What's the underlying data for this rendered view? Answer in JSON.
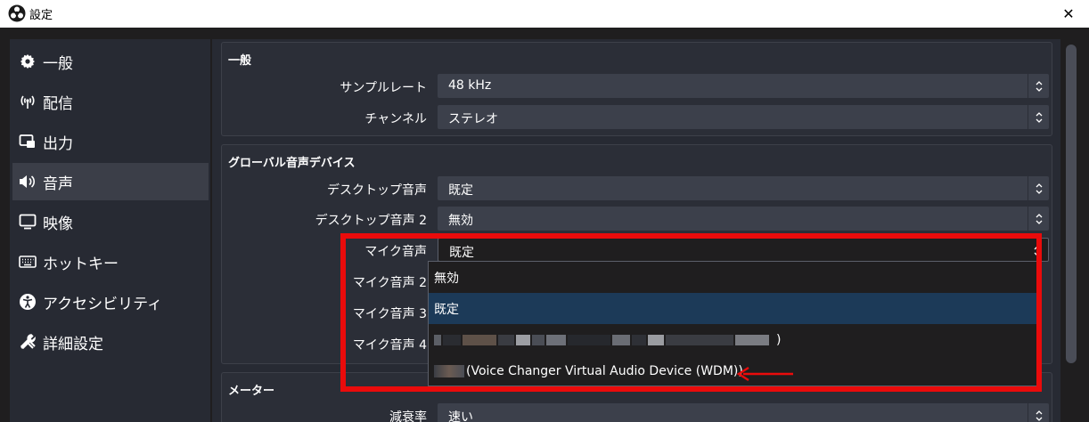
{
  "window": {
    "title": "設定",
    "close_glyph": "✕"
  },
  "sidebar": {
    "items": [
      {
        "label": "一般",
        "icon": "gear-icon"
      },
      {
        "label": "配信",
        "icon": "broadcast-icon"
      },
      {
        "label": "出力",
        "icon": "output-icon"
      },
      {
        "label": "音声",
        "icon": "speaker-icon",
        "active": true
      },
      {
        "label": "映像",
        "icon": "monitor-icon"
      },
      {
        "label": "ホットキー",
        "icon": "keyboard-icon"
      },
      {
        "label": "アクセシビリティ",
        "icon": "accessibility-icon"
      },
      {
        "label": "詳細設定",
        "icon": "tools-icon"
      }
    ]
  },
  "general_group": {
    "title": "一般",
    "sample_rate_label": "サンプルレート",
    "sample_rate_value": "48 kHz",
    "channels_label": "チャンネル",
    "channels_value": "ステレオ"
  },
  "devices_group": {
    "title": "グローバル音声デバイス",
    "desktop_label": "デスクトップ音声",
    "desktop_value": "既定",
    "desktop2_label": "デスクトップ音声 2",
    "desktop2_value": "無効",
    "mic_label": "マイク音声",
    "mic_value": "既定",
    "mic2_label": "マイク音声 2",
    "mic3_label": "マイク音声 3",
    "mic4_label": "マイク音声 4"
  },
  "mic_dropdown": {
    "options": [
      {
        "label": "無効"
      },
      {
        "label": "既定",
        "selected": true
      },
      {
        "label": ")",
        "blurred": true
      },
      {
        "label": "(Voice Changer Virtual Audio Device (WDM))",
        "blurred_prefix": true
      }
    ]
  },
  "meter_group": {
    "title": "メーター",
    "decay_label": "減衰率",
    "decay_value": "速い"
  },
  "colors": {
    "annotation_red": "#ea0b0b",
    "selected_item": "#1c3a58",
    "panel": "#272a33",
    "field": "#3c404b"
  }
}
